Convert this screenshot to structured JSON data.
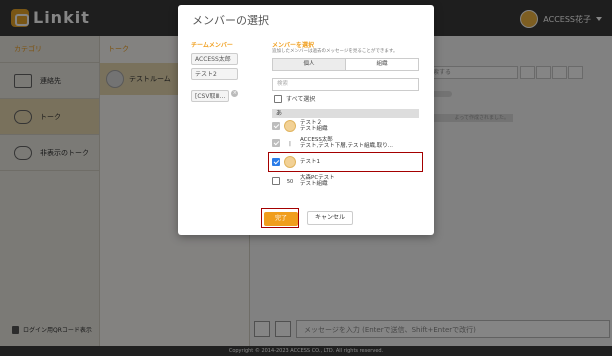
{
  "app": {
    "logo": "Linkit",
    "user_name": "ACCESS花子",
    "footer": "Copyright © 2014-2023 ACCESS CO., LTD. All rights reserved."
  },
  "sidebar": {
    "title": "カテゴリ",
    "items": [
      {
        "label": "連絡先",
        "icon": "contact-icon"
      },
      {
        "label": "トーク",
        "icon": "chat-bubble-icon"
      },
      {
        "label": "非表示のトーク",
        "icon": "hidden-chat-icon"
      }
    ],
    "bottom_label": "ログイン用QRコード表示"
  },
  "talk_list": {
    "title": "トーク",
    "item": "テストルーム"
  },
  "main": {
    "search_placeholder": "検索する",
    "system_message": "よって作成されました。",
    "composer_placeholder": "メッセージを入力 (Enterで送信、Shift+Enterで改行)"
  },
  "modal": {
    "title": "メンバーの選択",
    "team_title": "チームメンバー",
    "team_members": [
      "ACCESS太郎",
      "テスト2",
      "[CSV取Ⅲ..."
    ],
    "select_title": "メンバーを選択",
    "note": "追加したメンバーは過去のメッセージを見ることができます。",
    "tabs": [
      "個人",
      "組織"
    ],
    "search_placeholder": "検索",
    "select_all": "すべて選択",
    "group_label": "あ",
    "members": [
      {
        "name": "テスト２",
        "org": "テスト組織",
        "state": "disabled",
        "avatar": "person"
      },
      {
        "name": "ACCESS太郎",
        "org": "テスト,テスト下層,テスト組織,取り...",
        "state": "disabled",
        "avatar": "small"
      },
      {
        "name": "テスト1",
        "org": "",
        "state": "checked",
        "avatar": "person"
      },
      {
        "name": "大森PCテスト",
        "org": "テスト組織",
        "state": "unchecked",
        "avatar": "50"
      }
    ],
    "done": "完了",
    "cancel": "キャンセル"
  }
}
